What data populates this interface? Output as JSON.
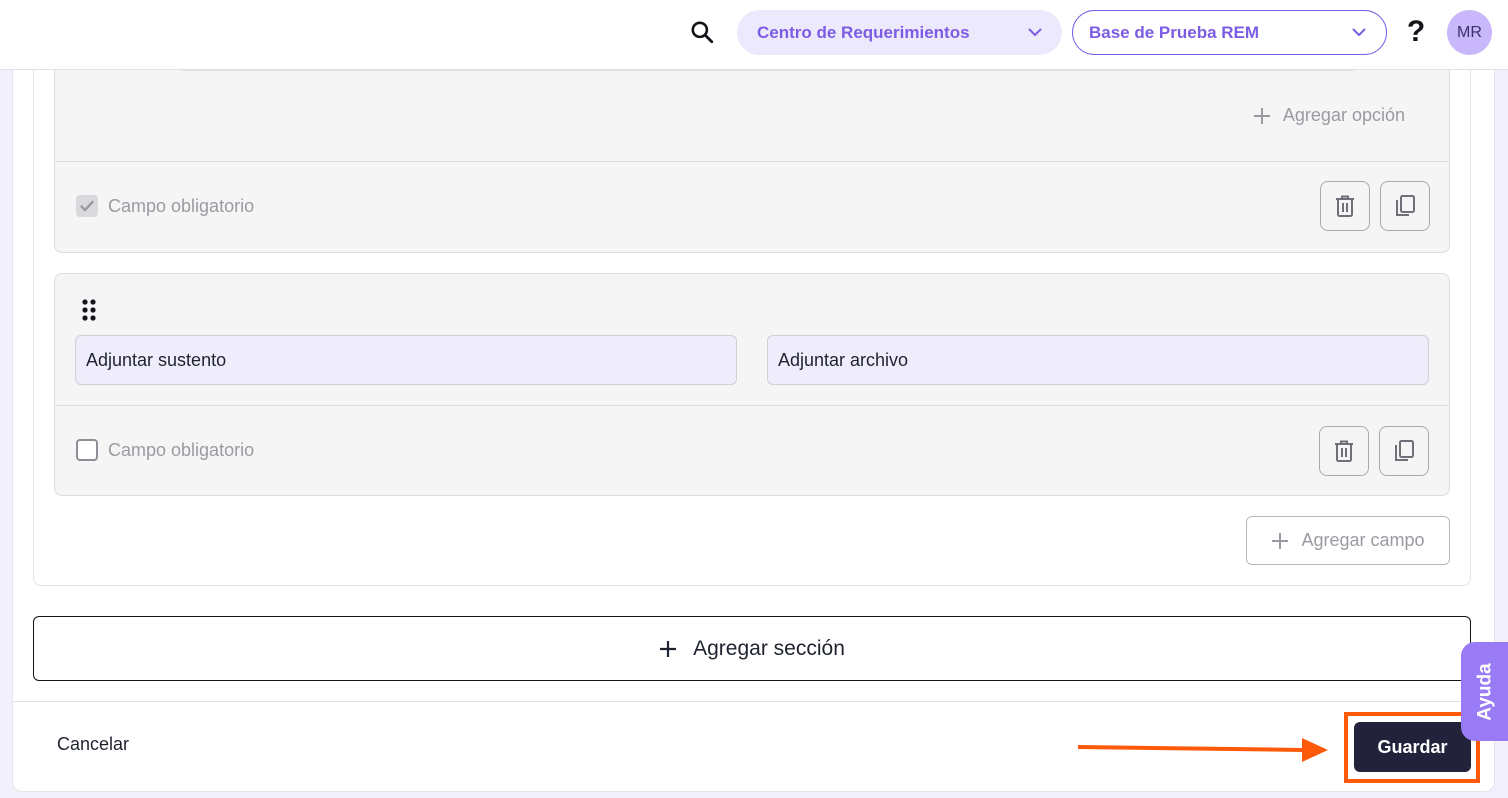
{
  "header": {
    "center_selector": "Centro de Requerimientos",
    "base_selector": "Base de Prueba REM",
    "help_glyph": "?",
    "avatar_initials": "MR"
  },
  "fields": [
    {
      "add_option_label": "Agregar opción",
      "required_label": "Campo obligatorio",
      "required_checked": true
    },
    {
      "name_value": "Adjuntar sustento",
      "type_value": "Adjuntar archivo",
      "required_label": "Campo obligatorio",
      "required_checked": false
    }
  ],
  "add_field_label": "Agregar campo",
  "add_section_label": "Agregar sección",
  "footer": {
    "cancel_label": "Cancelar",
    "save_label": "Guardar"
  },
  "help_tab_label": "Ayuda",
  "colors": {
    "accent": "#7c5ce4",
    "highlight": "#ff5a0a",
    "save_bg": "#22233a"
  }
}
